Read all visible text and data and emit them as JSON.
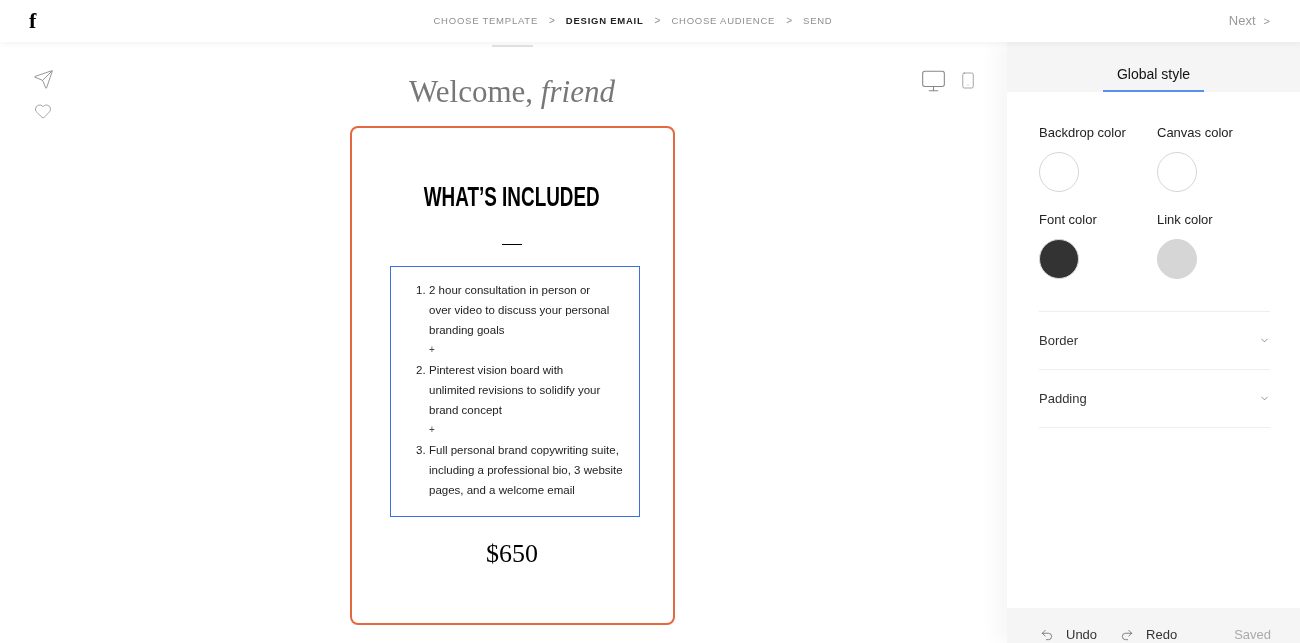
{
  "header": {
    "logo": "f",
    "steps": [
      {
        "label": "CHOOSE TEMPLATE",
        "selected": false,
        "separator": ">"
      },
      {
        "label": "DESIGN EMAIL",
        "selected": true,
        "separator": ">"
      },
      {
        "label": "CHOOSE AUDIENCE",
        "selected": false,
        "separator": ">"
      },
      {
        "label": "SEND",
        "selected": false
      }
    ],
    "next_button": {
      "label": "Next",
      "arrow": ">"
    }
  },
  "canvas": {
    "title": "Welcome, *friend*",
    "card": {
      "selected": true,
      "heading": "WHAT’S INCLUDED",
      "list": {
        "selected": true,
        "items": [
          {
            "number": "1.",
            "text": "2 hour consultation in person or\nover video to discuss your personal\nbranding goals",
            "separator": "+"
          },
          {
            "number": "2.",
            "text": "Pinterest vision board with\nunlimited revisions to solidify your\nbrand concept",
            "separator": "+"
          },
          {
            "number": "3.",
            "text": "Full personal brand copywriting suite,\nincluding a professional bio, 3 website\npages, and a welcome email"
          }
        ]
      },
      "price": "$650"
    }
  },
  "panel": {
    "tabs": [
      {
        "label": "Global style",
        "selected": true
      }
    ],
    "swatches": [
      {
        "label": "Backdrop color",
        "color": "#ffffff"
      },
      {
        "label": "Canvas color",
        "color": "#ffffff"
      },
      {
        "label": "Font color",
        "color": "#333333"
      },
      {
        "label": "Link color",
        "color": "#d6d6d6"
      }
    ],
    "sections": [
      {
        "label": "Border",
        "expanded": false
      },
      {
        "label": "Padding",
        "expanded": false
      }
    ]
  },
  "footer": {
    "undo": "Undo",
    "redo": "Redo",
    "status": "Saved"
  }
}
